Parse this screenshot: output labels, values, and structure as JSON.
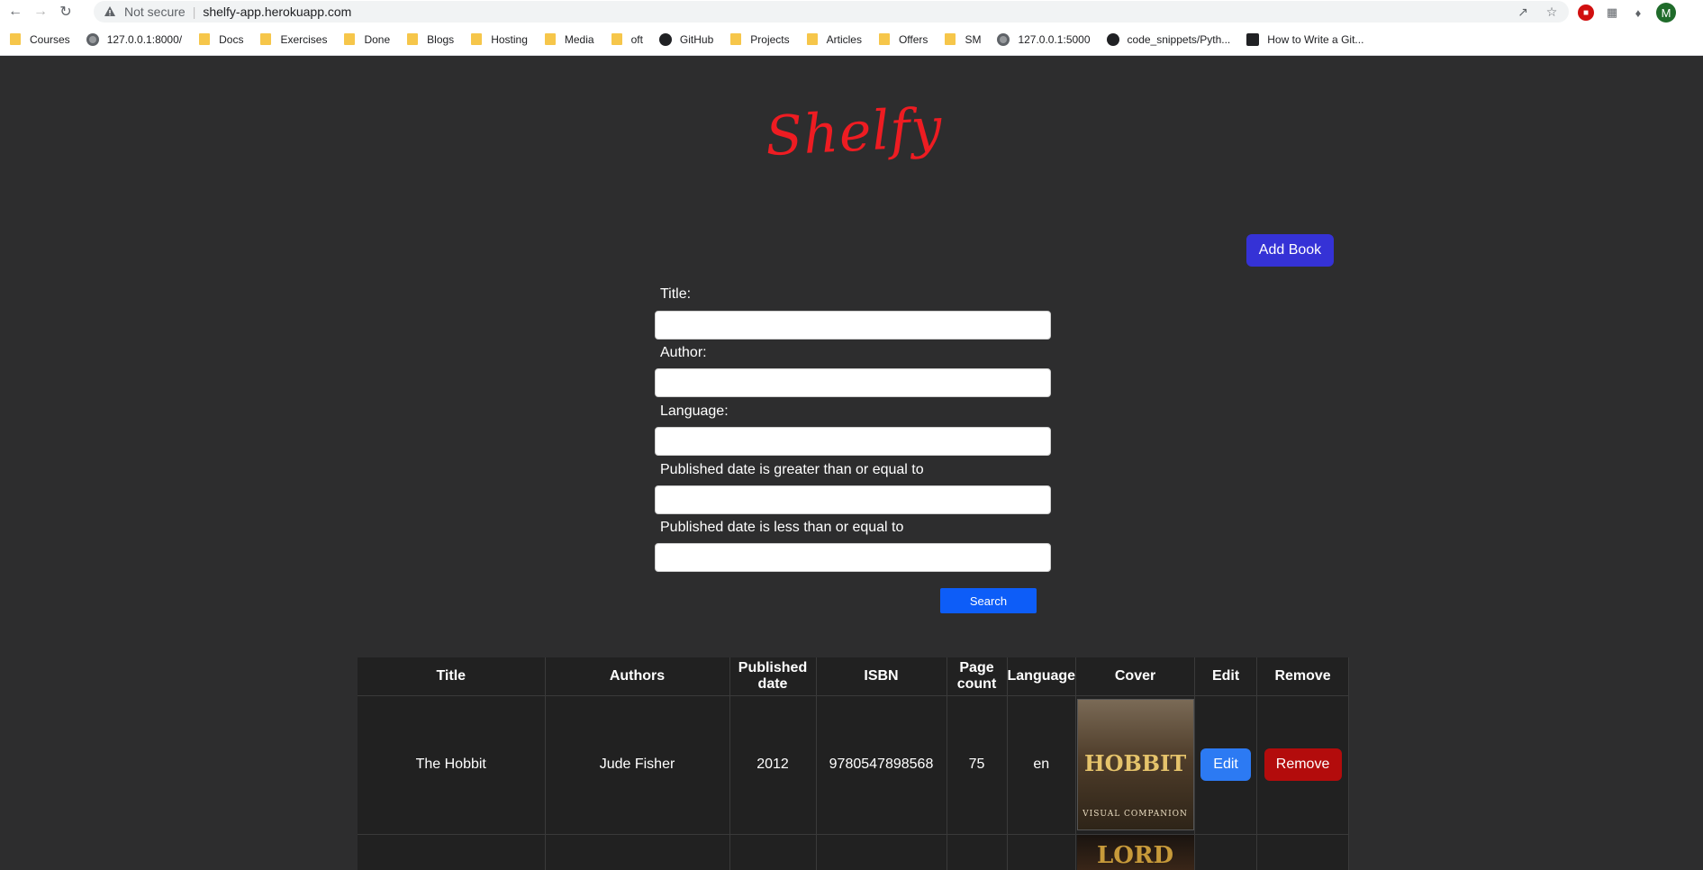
{
  "browser": {
    "url_warning": "Not secure",
    "url": "shelfy-app.herokuapp.com",
    "profile_initial": "M",
    "bookmarks": [
      {
        "label": "Courses",
        "icon": "folder-icon"
      },
      {
        "label": "127.0.0.1:8000/",
        "icon": "globe-icon"
      },
      {
        "label": "Docs",
        "icon": "folder-icon"
      },
      {
        "label": "Exercises",
        "icon": "folder-icon"
      },
      {
        "label": "Done",
        "icon": "folder-icon"
      },
      {
        "label": "Blogs",
        "icon": "folder-icon"
      },
      {
        "label": "Hosting",
        "icon": "folder-icon"
      },
      {
        "label": "Media",
        "icon": "folder-icon"
      },
      {
        "label": "oft",
        "icon": "folder-icon"
      },
      {
        "label": "GitHub",
        "icon": "github-icon"
      },
      {
        "label": "Projects",
        "icon": "folder-icon"
      },
      {
        "label": "Articles",
        "icon": "folder-icon"
      },
      {
        "label": "Offers",
        "icon": "folder-icon"
      },
      {
        "label": "SM",
        "icon": "folder-icon"
      },
      {
        "label": "127.0.0.1:5000",
        "icon": "globe-icon"
      },
      {
        "label": "code_snippets/Pyth...",
        "icon": "github-icon"
      },
      {
        "label": "How to Write a Git...",
        "icon": "dev-icon"
      }
    ]
  },
  "app": {
    "logo": "Shelfy",
    "add_book_label": "Add Book",
    "search_label": "Search",
    "filters": {
      "title_label": "Title:",
      "author_label": "Author:",
      "language_label": "Language:",
      "date_from_label": "Published date is greater than or equal to",
      "date_to_label": "Published date is less than or equal to"
    },
    "table": {
      "headers": {
        "title": "Title",
        "authors": "Authors",
        "published_line1": "Published",
        "published_line2": "date",
        "isbn": "ISBN",
        "page_line1": "Page",
        "page_line2": "count",
        "language": "Language",
        "cover": "Cover",
        "edit": "Edit",
        "remove": "Remove"
      },
      "rows": [
        {
          "title": "The Hobbit",
          "authors": "Jude Fisher",
          "published": "2012",
          "isbn": "9780547898568",
          "pages": "75",
          "language": "en",
          "cover_title": "HOBBIT",
          "cover_subtitle": "VISUAL COMPANION",
          "edit_label": "Edit",
          "remove_label": "Remove"
        }
      ],
      "next_cover_title": "LORD"
    }
  }
}
